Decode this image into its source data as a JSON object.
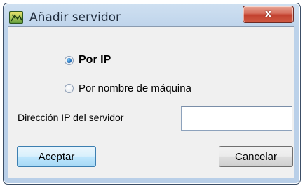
{
  "window": {
    "title": "Añadir servidor",
    "close_glyph": "x",
    "icon": "app-icon"
  },
  "options": {
    "by_ip_label": "Por IP",
    "by_name_label": "Por nombre de máquina",
    "selected": "by_ip"
  },
  "server_ip": {
    "label": "Dirección IP del servidor",
    "value": "",
    "placeholder": ""
  },
  "buttons": {
    "accept_label": "Aceptar",
    "cancel_label": "Cancelar"
  },
  "colors": {
    "frame": "#bcd2ea",
    "client": "#f0f0f0",
    "close_button": "#c2402e",
    "default_button_border": "#3c7fb1"
  }
}
